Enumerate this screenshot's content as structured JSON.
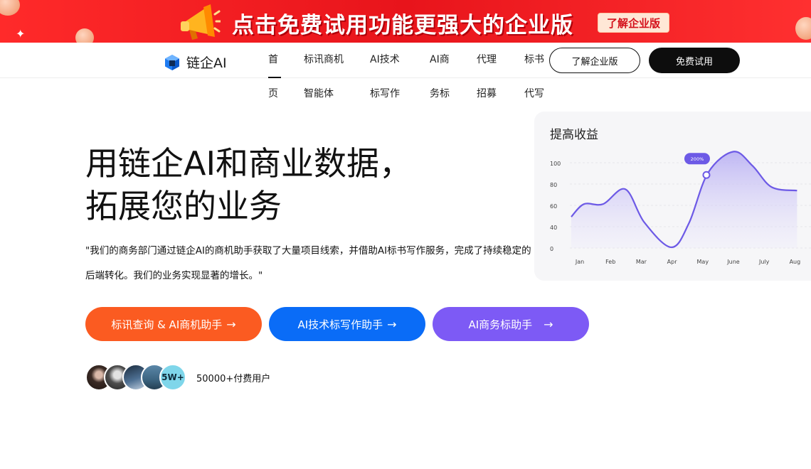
{
  "promo": {
    "headline": "点击免费试用功能更强大的企业版",
    "cta": "了解企业版",
    "icon": "megaphone-icon",
    "colors": {
      "bg": "#e8141b",
      "cta_text": "#d4101a"
    }
  },
  "nav": {
    "logo_text": "链企AI",
    "items": [
      {
        "line1": "首",
        "line2": "页"
      },
      {
        "line1": "标讯商机",
        "line2": "智能体"
      },
      {
        "line1": "AI技术",
        "line2": "标写作"
      },
      {
        "line1": "AI商",
        "line2": "务标"
      },
      {
        "line1": "代理",
        "line2": "招募"
      },
      {
        "line1": "标书",
        "line2": "代写"
      }
    ],
    "enterprise_button": "了解企业版",
    "trial_button": "免费试用"
  },
  "hero": {
    "title_line1": "用链企AI和商业数据，",
    "title_line2": "拓展您的业务",
    "quote": "\"我们的商务部门通过链企AI的商机助手获取了大量项目线索，并借助AI标书写作服务，完成了持续稳定的后端转化。我们的业务实现显著的增长。\"",
    "buttons": [
      {
        "label": "标讯查询 & AI商机助手",
        "color": "#fb5b21"
      },
      {
        "label": "AI技术标写作助手",
        "color": "#0a6cf7"
      },
      {
        "label": "AI商务标助手",
        "color": "#7d5af5"
      }
    ],
    "arrow": "→",
    "users_badge": "5W+",
    "users_label": "50000+付费用户"
  },
  "chart_card": {
    "title": "提高收益",
    "chart_data": {
      "type": "area",
      "categories": [
        "Jan",
        "Feb",
        "Mar",
        "Apr",
        "May",
        "June",
        "July",
        "Aug"
      ],
      "values": [
        48,
        66,
        66,
        87,
        40,
        5,
        39,
        110,
        140,
        120,
        90,
        85
      ],
      "x": [
        0,
        0.4,
        1,
        1.7,
        2.3,
        3.15,
        3.7,
        4.3,
        5.1,
        5.7,
        6.3,
        7.1
      ],
      "yticks": [
        0,
        20,
        40,
        60,
        80,
        100
      ],
      "ytick_labels": [
        "0",
        "40",
        "60",
        "80",
        "100"
      ],
      "ylim": [
        0,
        150
      ],
      "highlight": {
        "x": 4.25,
        "y": 107,
        "label": "200%"
      },
      "color": "#6d5ae6"
    }
  }
}
